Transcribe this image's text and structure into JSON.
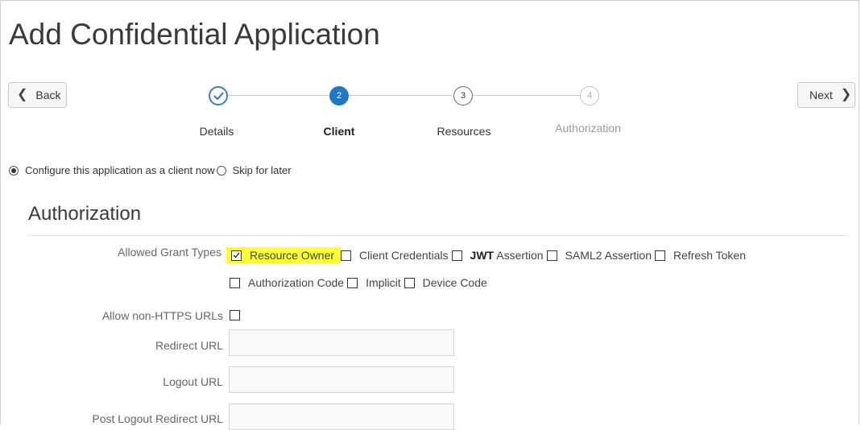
{
  "page": {
    "title": "Add Confidential Application"
  },
  "nav": {
    "back_label": "Back",
    "next_label": "Next"
  },
  "wizard": {
    "steps": [
      {
        "number": "1",
        "label": "Details",
        "state": "completed"
      },
      {
        "number": "2",
        "label": "Client",
        "state": "active"
      },
      {
        "number": "3",
        "label": "Resources",
        "state": "pending"
      },
      {
        "number": "4",
        "label": "Authorization",
        "state": "disabled"
      }
    ]
  },
  "client_mode": {
    "option_now": "Configure this application as a client now",
    "option_later": "Skip for later",
    "selected": "now"
  },
  "section": {
    "title": "Authorization"
  },
  "grant_types": {
    "label": "Allowed Grant Types",
    "options": [
      {
        "label": "Resource Owner",
        "checked": true
      },
      {
        "label_prefix": "",
        "label": "Client Credentials",
        "checked": false
      },
      {
        "label_bold": "JWT",
        "label": " Assertion",
        "checked": false
      },
      {
        "label": "SAML2 Assertion",
        "checked": false
      },
      {
        "label": "Refresh Token",
        "checked": false
      },
      {
        "label": "Authorization Code",
        "checked": false
      },
      {
        "label": "Implicit",
        "checked": false
      },
      {
        "label": "Device Code",
        "checked": false
      }
    ]
  },
  "non_https": {
    "label": "Allow non-HTTPS URLs",
    "checked": false
  },
  "redirect_url": {
    "label": "Redirect URL",
    "value": ""
  },
  "logout_url": {
    "label": "Logout URL",
    "value": ""
  },
  "post_logout_url": {
    "label": "Post Logout Redirect URL",
    "value": ""
  },
  "colors": {
    "accent": "#1f77c6",
    "highlight": "#ffff33"
  },
  "icons": {
    "back": "chevron-left-icon",
    "next": "chevron-right-icon",
    "done": "checkmark-icon"
  }
}
